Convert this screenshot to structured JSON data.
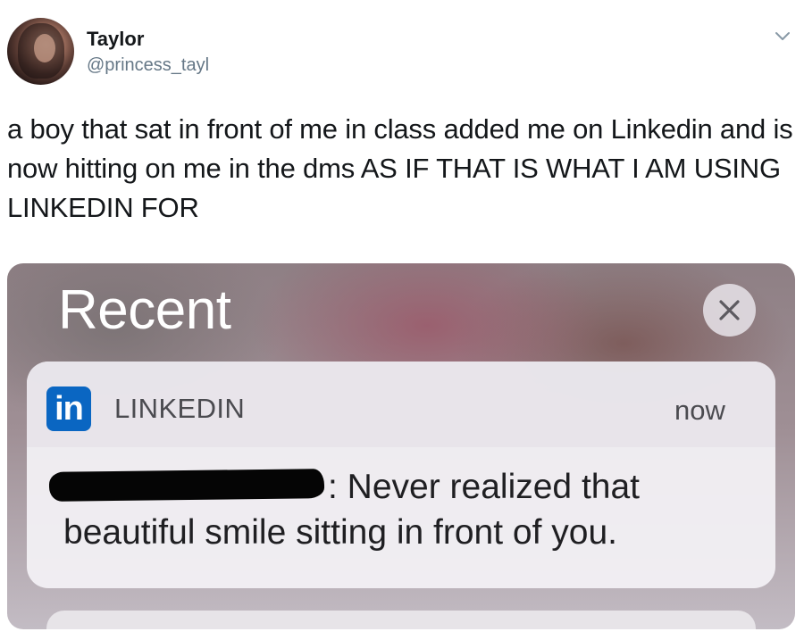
{
  "tweet": {
    "author_name": "Taylor",
    "author_handle": "@princess_tayl",
    "text": "a boy that sat in front of me in class added me on Linkedin and is now hitting on me in the dms AS IF THAT IS WHAT I AM USING LINKEDIN FOR"
  },
  "media": {
    "section_title": "Recent",
    "notification": {
      "app_logo_text": "in",
      "app_name": "LINKEDIN",
      "time": "now",
      "message_suffix": ": Never realized that",
      "message_line_2": "beautiful smile sitting in front of you."
    }
  },
  "icons": {
    "avatar": "profile-photo",
    "menu": "chevron-down-icon",
    "close": "close-icon",
    "app": "linkedin-logo",
    "redaction": "redaction-bar"
  },
  "colors": {
    "linkedin_blue": "#0a66c2",
    "handle_gray": "#657786",
    "text_dark": "#14171a"
  }
}
